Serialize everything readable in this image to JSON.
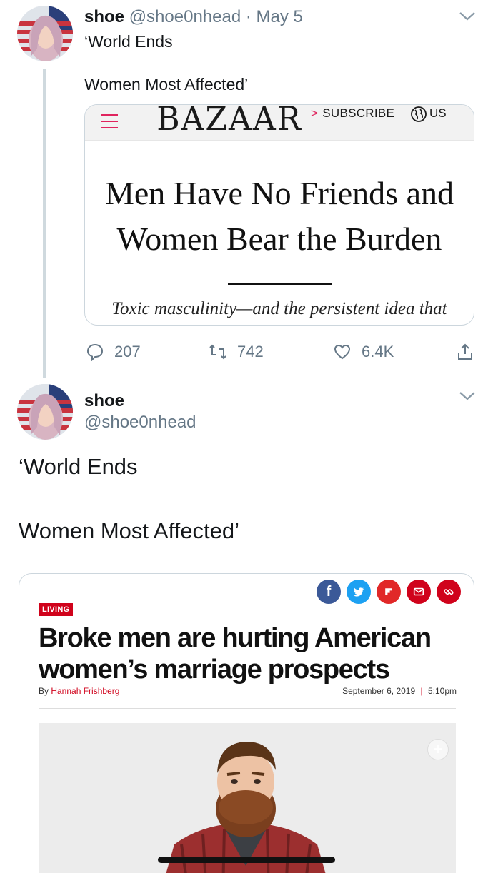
{
  "tweet1": {
    "name": "shoe",
    "handle": "@shoe0nhead",
    "date_sep": " · ",
    "date": "May 5",
    "text_line1": "‘World Ends",
    "text_line2": "Women Most Affected’",
    "card": {
      "logo": "BAZAAR",
      "subscribe": "SUBSCRIBE",
      "subscribe_arrow": ">",
      "region": "US",
      "headline_line1": "Men Have No Friends and",
      "headline_line2": "Women Bear the Burden",
      "dek": "Toxic masculinity—and the persistent idea that",
      "menu_color": "#e0245e"
    },
    "actions": {
      "replies": "207",
      "retweets": "742",
      "likes": "6.4K"
    }
  },
  "tweet2": {
    "name": "shoe",
    "handle": "@shoe0nhead",
    "text_line1": "‘World Ends",
    "text_line2": "Women Most Affected’",
    "card": {
      "section_tag": "LIVING",
      "headline_line1": "Broke men are hurting American",
      "headline_line2": "women’s marriage prospects",
      "byline_prefix": "By ",
      "author": "Hannah Frishberg",
      "date": "September 6, 2019",
      "date_sep": "|",
      "time": "5:10pm",
      "share_buttons": [
        {
          "name": "facebook",
          "glyph": "f",
          "color": "#3b5998"
        },
        {
          "name": "twitter",
          "glyph": "t",
          "color": "#1da1f2"
        },
        {
          "name": "flipboard",
          "glyph": "F",
          "color": "#e12828"
        },
        {
          "name": "email",
          "glyph": "✉",
          "color": "#d0021b"
        },
        {
          "name": "link",
          "glyph": "∞",
          "color": "#d0021b"
        }
      ],
      "accent_color": "#d0021b"
    }
  },
  "colors": {
    "text": "#14171a",
    "secondary": "#657786",
    "border": "#ccd6dd",
    "thread_line": "#cfd9de"
  }
}
